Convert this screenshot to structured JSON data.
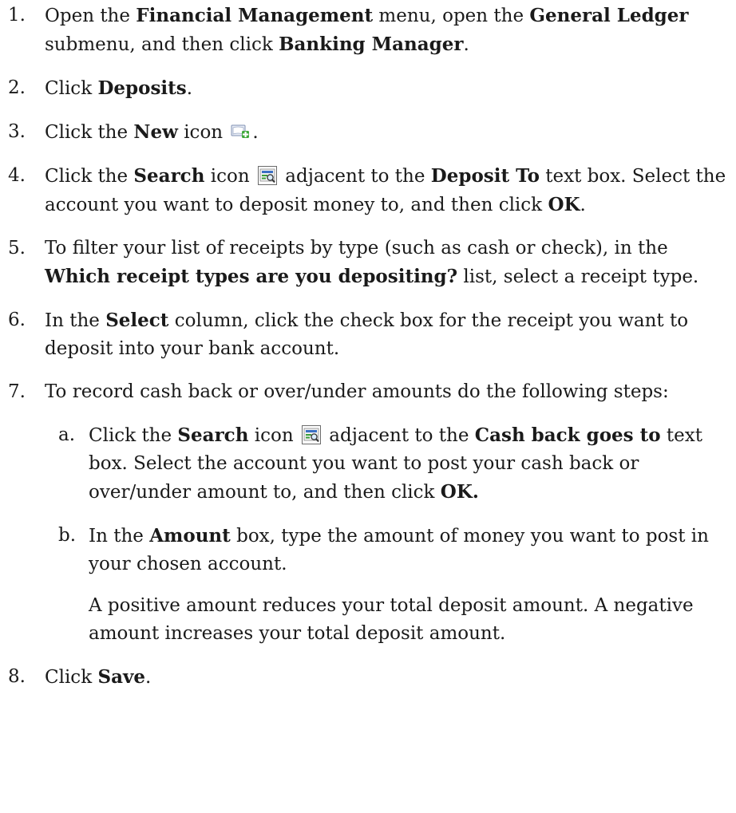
{
  "steps": [
    {
      "num": "1.",
      "parts": [
        {
          "t": "Open the "
        },
        {
          "b": "Financial Management"
        },
        {
          "t": " menu, open the "
        },
        {
          "b": "General Ledger"
        },
        {
          "t": " submenu, and then click "
        },
        {
          "b": "Banking Manager"
        },
        {
          "t": "."
        }
      ]
    },
    {
      "num": "2.",
      "parts": [
        {
          "t": "Click "
        },
        {
          "b": "Deposits"
        },
        {
          "t": "."
        }
      ]
    },
    {
      "num": "3.",
      "parts": [
        {
          "t": "Click the "
        },
        {
          "b": "New"
        },
        {
          "t": " icon "
        },
        {
          "icon": "new-icon"
        },
        {
          "t": "."
        }
      ]
    },
    {
      "num": "4.",
      "parts": [
        {
          "t": "Click the "
        },
        {
          "b": "Search"
        },
        {
          "t": " icon "
        },
        {
          "icon": "search-icon"
        },
        {
          "t": " adjacent to the "
        },
        {
          "b": "Deposit To"
        },
        {
          "t": " text box. Select the account you want to deposit money to, and then click "
        },
        {
          "b": "OK"
        },
        {
          "t": "."
        }
      ]
    },
    {
      "num": "5.",
      "parts": [
        {
          "t": "To filter your list of receipts by type (such as cash or check), in the "
        },
        {
          "b": "Which receipt types are you depositing?"
        },
        {
          "t": " list, select a receipt type."
        }
      ]
    },
    {
      "num": "6.",
      "parts": [
        {
          "t": "In the "
        },
        {
          "b": "Select"
        },
        {
          "t": " column, click the check box for the receipt you want to deposit into your bank account."
        }
      ]
    },
    {
      "num": "7.",
      "parts": [
        {
          "t": "To record cash back or over/under amounts do the following steps:"
        }
      ],
      "substeps": [
        {
          "num": "a.",
          "parts": [
            {
              "t": "Click the "
            },
            {
              "b": "Search"
            },
            {
              "t": " icon "
            },
            {
              "icon": "search-icon"
            },
            {
              "t": " adjacent to the "
            },
            {
              "b": "Cash back goes to"
            },
            {
              "t": " text box. Select the account you want to post your cash back or over/under amount to, and then click "
            },
            {
              "b": "OK."
            }
          ]
        },
        {
          "num": "b.",
          "parts": [
            {
              "t": "In the "
            },
            {
              "b": "Amount"
            },
            {
              "t": " box, type the amount of money you want to post in your chosen account."
            }
          ],
          "note": "A positive amount reduces your total deposit amount. A negative amount increases your total deposit amount."
        }
      ]
    },
    {
      "num": "8.",
      "parts": [
        {
          "t": "Click "
        },
        {
          "b": "Save"
        },
        {
          "t": "."
        }
      ]
    }
  ]
}
